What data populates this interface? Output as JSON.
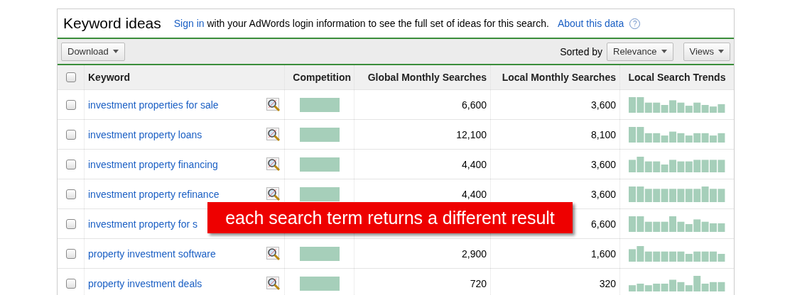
{
  "header": {
    "title": "Keyword ideas",
    "sign_in_link": "Sign in",
    "message": "with your AdWords login information to see the full set of ideas for this search.",
    "about_link": "About this data",
    "help_icon": "?"
  },
  "toolbar": {
    "download": "Download",
    "sorted_by_label": "Sorted by",
    "sort": "Relevance",
    "views": "Views"
  },
  "table": {
    "columns": [
      "Keyword",
      "Competition",
      "Global Monthly Searches",
      "Local Monthly Searches",
      "Local Search Trends"
    ],
    "select_all_checked": false,
    "rows": [
      {
        "keyword": "investment properties for sale",
        "checked": false,
        "competition": {
          "level": 1
        },
        "global": "6,600",
        "local": "3,600"
      },
      {
        "keyword": "investment property loans",
        "checked": false,
        "competition": {
          "level": 1
        },
        "global": "12,100",
        "local": "8,100"
      },
      {
        "keyword": "investment property financing",
        "checked": false,
        "competition": {
          "level": 1
        },
        "global": "4,400",
        "local": "3,600"
      },
      {
        "keyword": "investment property refinance",
        "checked": false,
        "competition": {
          "level": 1
        },
        "global": "4,400",
        "local": "3,600"
      },
      {
        "keyword": "investment property for s",
        "checked": false,
        "local": "6,600"
      },
      {
        "keyword": "property investment software",
        "checked": false,
        "competition": {
          "level": 1
        },
        "global": "2,900",
        "local": "1,600"
      },
      {
        "keyword": "property investment deals",
        "checked": false,
        "competition": {
          "level": 1
        },
        "global": "720",
        "local": "320"
      }
    ]
  },
  "callout": {
    "text": "each search term returns a different result"
  }
}
